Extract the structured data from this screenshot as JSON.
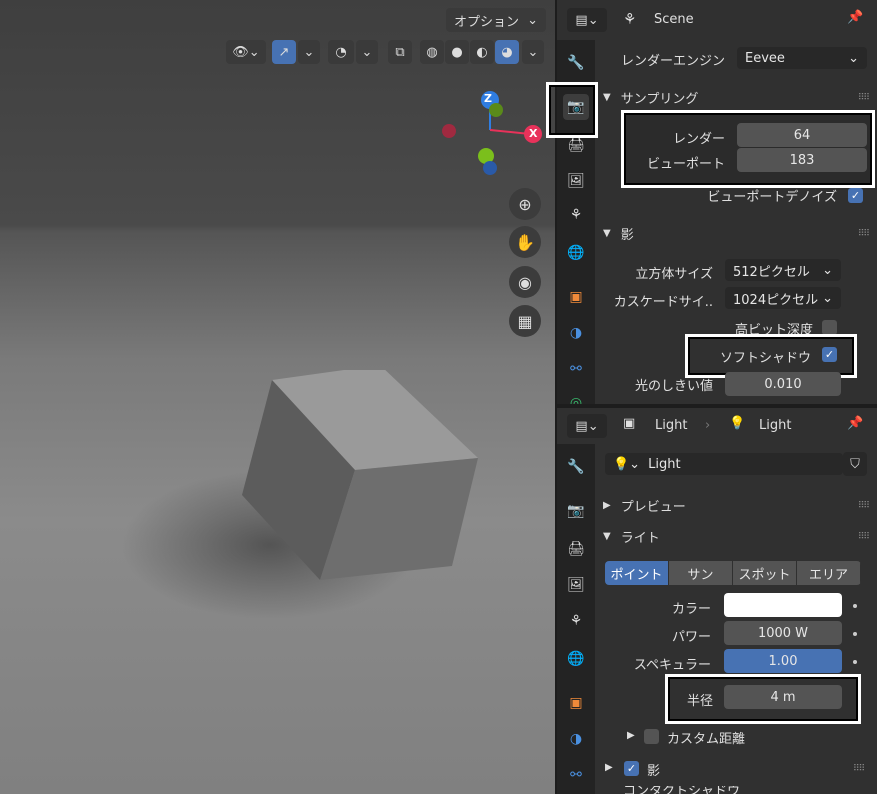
{
  "viewport": {
    "options_label": "オプション"
  },
  "gizmo": {
    "z": "Z",
    "x": "X"
  },
  "scene_header": {
    "title": "Scene"
  },
  "render": {
    "engine_label": "レンダーエンジン",
    "engine_value": "Eevee",
    "sampling_title": "サンプリング",
    "render_label": "レンダー",
    "render_value": "64",
    "viewport_label": "ビューポート",
    "viewport_value": "183",
    "viewport_denoise_label": "ビューポートデノイズ",
    "shadow_title": "影",
    "cube_size_label": "立方体サイズ",
    "cube_size_value": "512ピクセル",
    "cascade_size_label": "カスケードサイ..",
    "cascade_size_value": "1024ピクセル",
    "high_bit_label": "高ビット深度",
    "soft_shadow_label": "ソフトシャドウ",
    "light_threshold_label": "光のしきい値",
    "light_threshold_value": "0.010"
  },
  "light_header": {
    "object": "Light",
    "data": "Light"
  },
  "light": {
    "name_value": "Light",
    "preview_title": "プレビュー",
    "light_title": "ライト",
    "types": [
      "ポイント",
      "サン",
      "スポット",
      "エリア"
    ],
    "color_label": "カラー",
    "color_value": "#ffffff",
    "power_label": "パワー",
    "power_value": "1000 W",
    "specular_label": "スペキュラー",
    "specular_value": "1.00",
    "specular_fraction": 1.0,
    "radius_label": "半径",
    "radius_value": "4 m",
    "custom_distance_label": "カスタム距離",
    "shadow_label": "影",
    "partial_bottom_label": "コンタクトシャドウ"
  },
  "colors": {
    "accent": "#4772b3",
    "panel": "#303030",
    "field": "#545454",
    "x_axis": "#e8325a",
    "z_axis": "#2f7de1",
    "y_axis": "#7bbf1c"
  }
}
